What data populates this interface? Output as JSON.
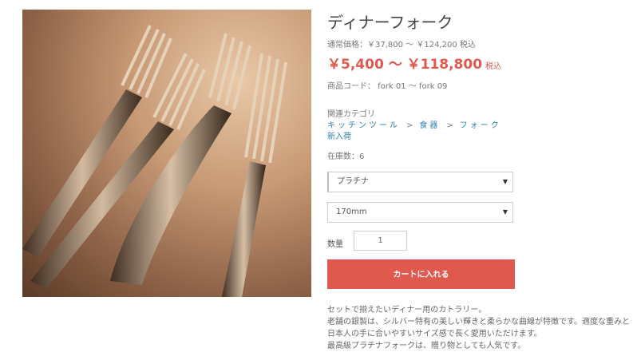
{
  "product": {
    "image_alt": "dinner forks on tablecloth",
    "title": "ディナーフォーク",
    "regular_price": "通常価格：￥37,800 ～ ￥124,200 税込",
    "sale_price": "￥5,400 ～ ￥118,800",
    "sale_tax": "税込",
    "product_code": "商品コード： fork 01 ～ fork 09",
    "related_category_title": "関連カテゴリ",
    "breadcrumb": [
      "キッチンツール",
      "食器",
      "フォーク"
    ],
    "breadcrumb_sep": ">",
    "new_arrival_link": "新入荷",
    "stock": "在庫数：6",
    "material_select": "プラチナ",
    "size_select": "170mm",
    "quantity_label": "数量",
    "quantity_value": "1",
    "add_to_cart": "カートに入れる",
    "description": [
      "セットで揃えたいディナー用のカトラリー。",
      "老舗の銀製は、シルバー特有の美しい輝きと柔らかな曲線が特徴です。適度な重みと日本人の手に合いやすいサイズ感で長く愛用いただけます。",
      "最高級プラチナフォークは、贈り物としても人気です。"
    ]
  },
  "colors": {
    "accent": "#e0594f",
    "link": "#2d7fb8"
  }
}
